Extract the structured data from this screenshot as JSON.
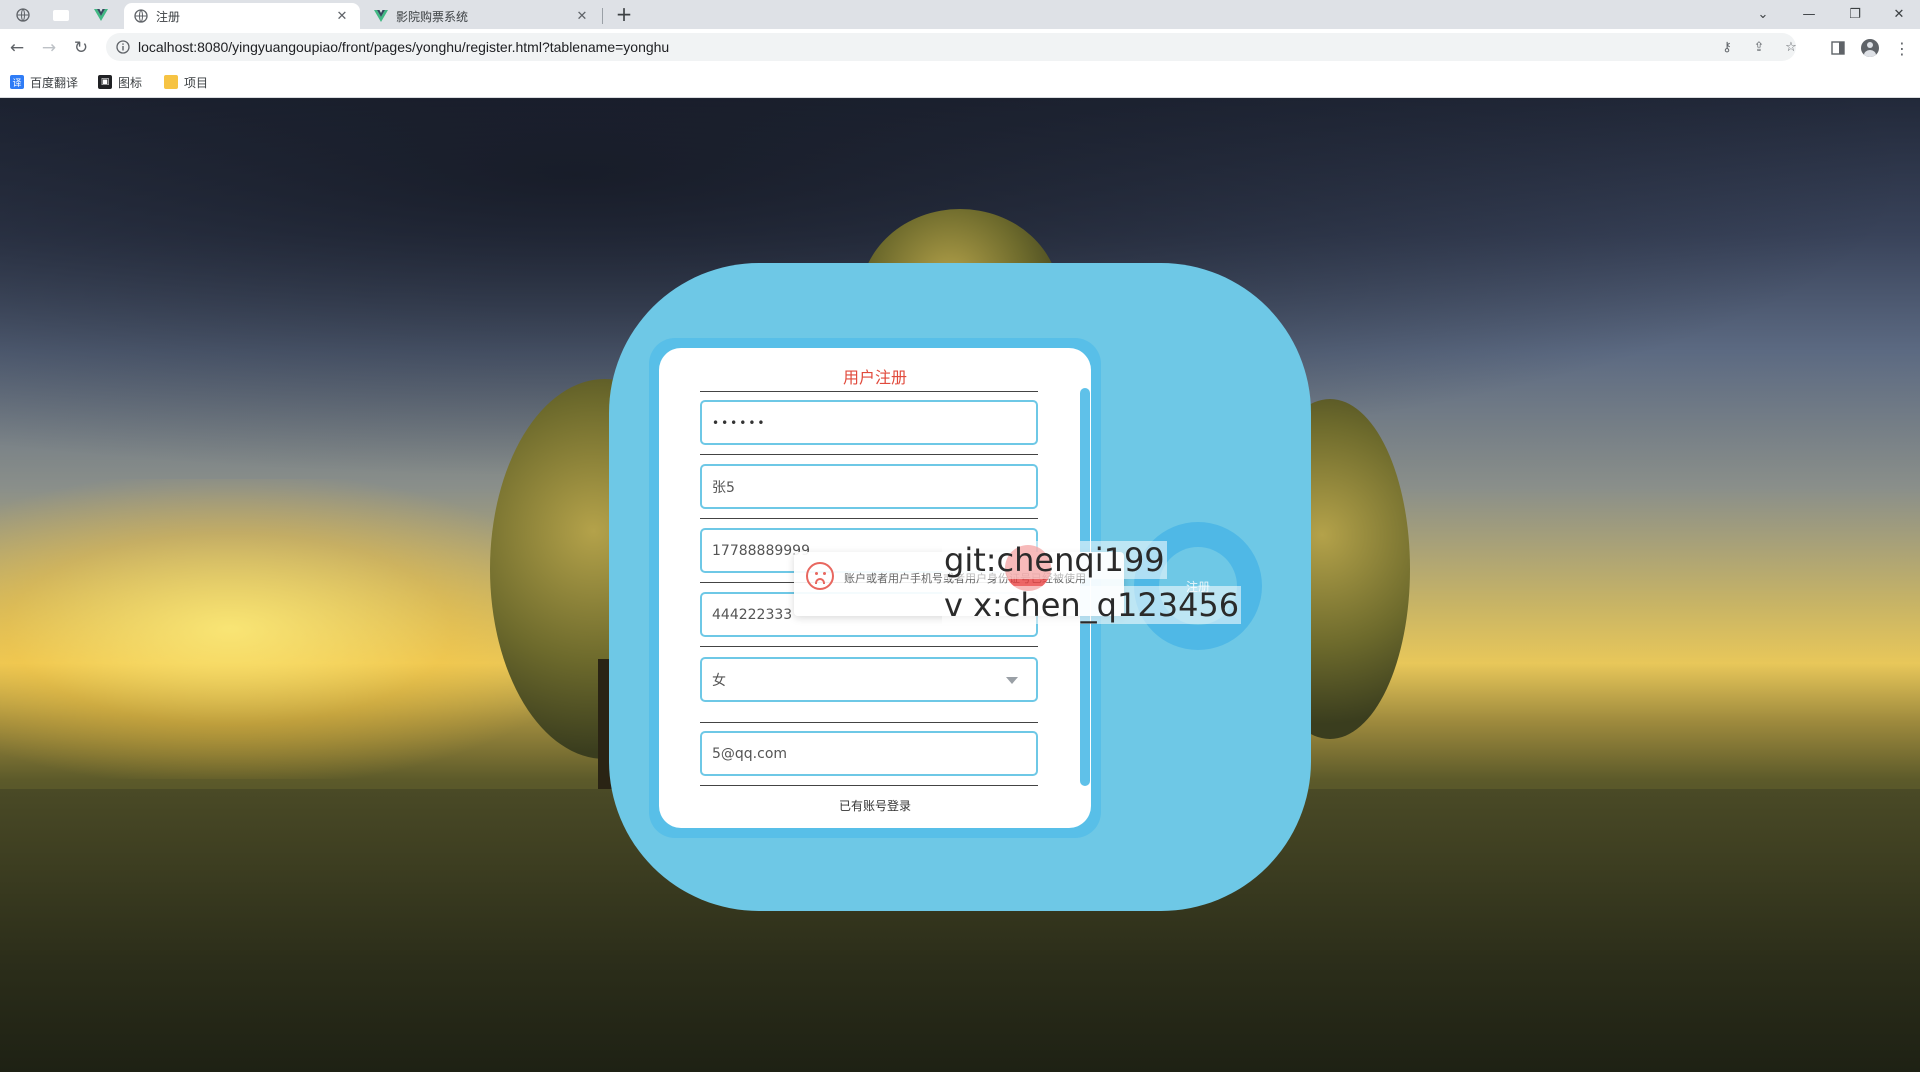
{
  "browser": {
    "tabs": [
      {
        "title": "注册",
        "active": true
      },
      {
        "title": "影院购票系统",
        "active": false
      }
    ],
    "url": "localhost:8080/yingyuangoupiao/front/pages/yonghu/register.html?tablename=yonghu",
    "bookmarks": [
      "百度翻译",
      "图标",
      "项目"
    ]
  },
  "form": {
    "title": "用户注册",
    "password_value": "••••••",
    "name_value": "张5",
    "phone_value": "17788889999",
    "id_value": "444222333",
    "gender_value": "女",
    "email_value": "5@qq.com",
    "login_link": "已有账号登录",
    "register_button": "注册"
  },
  "toast": {
    "message": "账户或者用户手机号或者用户身份证号已经被使用"
  },
  "watermark": {
    "line1": "git:chenqi199",
    "line2": "v x:chen_q123456"
  },
  "colors": {
    "card": "#6ec8e6",
    "title": "#e14a3c",
    "error": "#e8675f"
  }
}
